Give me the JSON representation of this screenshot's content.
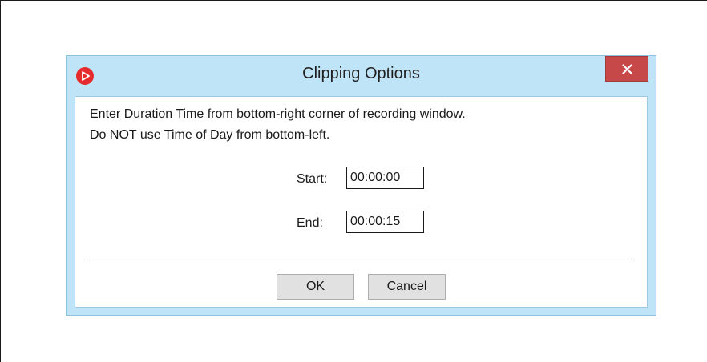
{
  "dialog": {
    "title": "Clipping Options",
    "app_icon": "play-circle-icon",
    "close_icon": "close-icon",
    "message_line1": "Enter Duration Time from bottom-right corner of recording window.",
    "message_line2": "Do NOT use Time of Day from bottom-left.",
    "start_label": "Start:",
    "start_value": "00:00:00",
    "end_label": "End:",
    "end_value": "00:00:15",
    "ok_label": "OK",
    "cancel_label": "Cancel"
  },
  "colors": {
    "title_bar": "#c0e4f7",
    "close_button": "#c74848",
    "app_icon": "#e52b2b",
    "button_face": "#e1e1e1"
  }
}
